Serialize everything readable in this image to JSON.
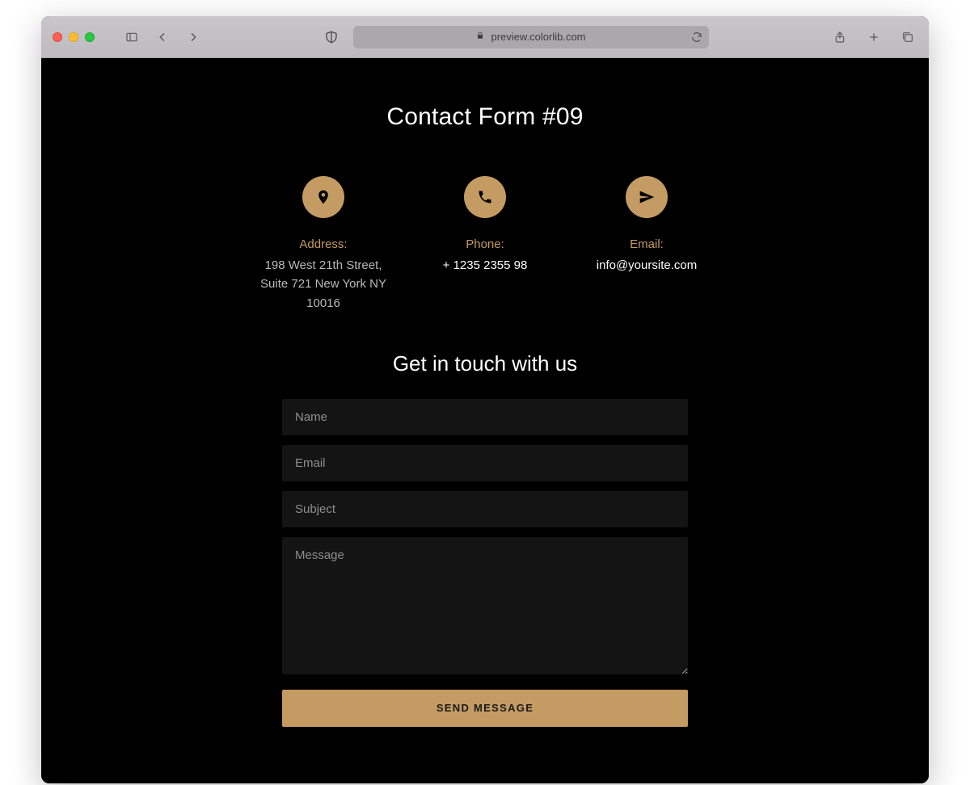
{
  "browser": {
    "url_display": "preview.colorlib.com"
  },
  "page": {
    "title": "Contact Form #09",
    "info": {
      "address": {
        "label": "Address:",
        "value": "198 West 21th Street, Suite 721 New York NY 10016"
      },
      "phone": {
        "label": "Phone:",
        "value": "+ 1235 2355 98"
      },
      "email": {
        "label": "Email:",
        "value": "info@yoursite.com"
      }
    },
    "form": {
      "title": "Get in touch with us",
      "name": {
        "placeholder": "Name",
        "value": ""
      },
      "email": {
        "placeholder": "Email",
        "value": ""
      },
      "subject": {
        "placeholder": "Subject",
        "value": ""
      },
      "message": {
        "placeholder": "Message",
        "value": ""
      },
      "submit_label": "SEND MESSAGE"
    }
  }
}
